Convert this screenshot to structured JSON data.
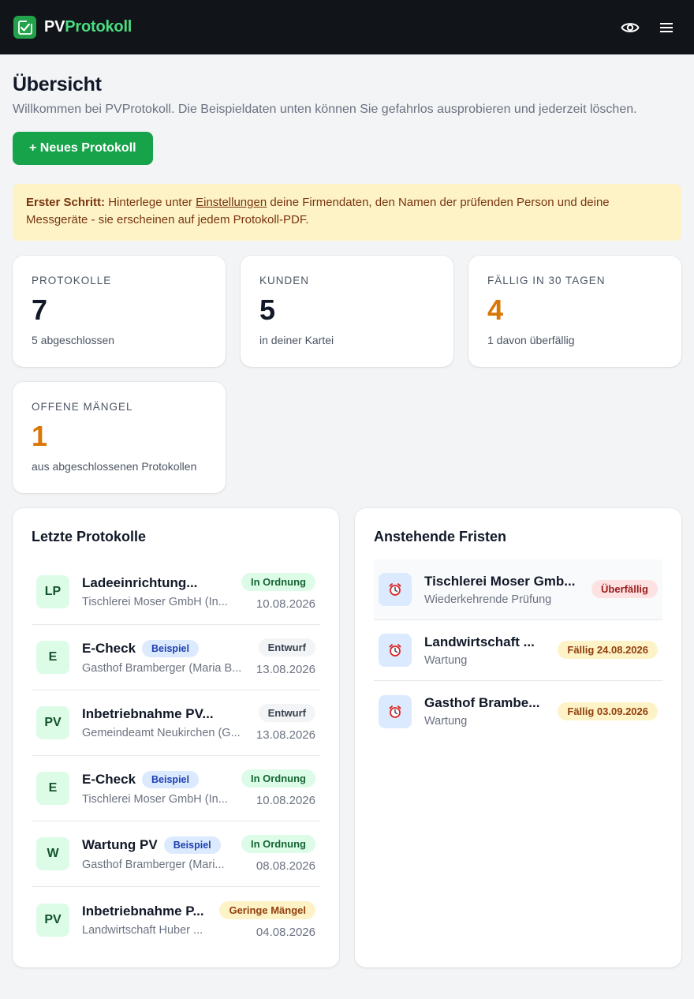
{
  "brand": {
    "name_part1": "PV",
    "name_part2": "Protokoll"
  },
  "page": {
    "title": "Übersicht",
    "subtitle": "Willkommen bei PVProtokoll. Die Beispieldaten unten können Sie gefahrlos ausprobieren und jederzeit löschen.",
    "new_button": "+ Neues Protokoll"
  },
  "notice": {
    "strong": "Erster Schritt:",
    "before_link": " Hinterlege unter ",
    "link": "Einstellungen",
    "after_link": " deine Firmendaten, den Namen der prüfenden Person und deine Messgeräte - sie erscheinen auf jedem Protokoll-PDF."
  },
  "stats": [
    {
      "label": "Protokolle",
      "value": "7",
      "note": "5 abgeschlossen"
    },
    {
      "label": "Kunden",
      "value": "5",
      "note": "in deiner Kartei"
    },
    {
      "label": "Fällig in 30 Tagen",
      "value": "4",
      "note": "1 davon überfällig"
    },
    {
      "label": "Offene Mängel",
      "value": "1",
      "note": "aus abgeschlossenen Protokollen"
    }
  ],
  "recent": {
    "title": "Letzte Protokolle",
    "items": [
      {
        "initials": "LP",
        "title": "Ladeeinrichtung...",
        "tag": "",
        "sub": "Tischlerei Moser GmbH (In...",
        "status": "In Ordnung",
        "date": "10.08.2026"
      },
      {
        "initials": "E",
        "title": "E-Check",
        "tag": "Beispiel",
        "sub": "Gasthof Bramberger (Maria B...",
        "status": "Entwurf",
        "date": "13.08.2026"
      },
      {
        "initials": "PV",
        "title": "Inbetriebnahme PV...",
        "tag": "",
        "sub": "Gemeindeamt Neukirchen (G...",
        "status": "Entwurf",
        "date": "13.08.2026"
      },
      {
        "initials": "E",
        "title": "E-Check",
        "tag": "Beispiel",
        "sub": "Tischlerei Moser GmbH (In...",
        "status": "In Ordnung",
        "date": "10.08.2026"
      },
      {
        "initials": "W",
        "title": "Wartung PV",
        "tag": "Beispiel",
        "sub": "Gasthof Bramberger (Mari...",
        "status": "In Ordnung",
        "date": "08.08.2026"
      },
      {
        "initials": "PV",
        "title": "Inbetriebnahme P...",
        "tag": "",
        "sub": "Landwirtschaft Huber ...",
        "status": "Geringe Mängel",
        "date": "04.08.2026"
      }
    ]
  },
  "deadlines": {
    "title": "Anstehende Fristen",
    "items": [
      {
        "title": "Tischlerei Moser Gmb...",
        "sub": "Wiederkehrende Prüfung",
        "status": "Überfällig"
      },
      {
        "title": "Landwirtschaft ...",
        "sub": "Wartung",
        "status": "Fällig 24.08.2026"
      },
      {
        "title": "Gasthof Brambe...",
        "sub": "Wartung",
        "status": "Fällig 03.09.2026"
      }
    ]
  },
  "colors": {
    "brand_green": "#16a34a",
    "accent_orange": "#d97706",
    "topbar": "#111418"
  }
}
